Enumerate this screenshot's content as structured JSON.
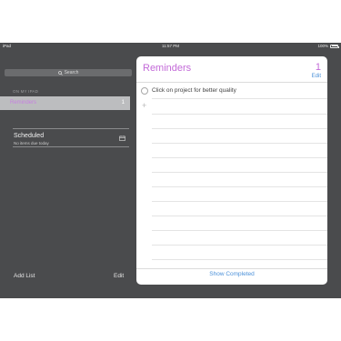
{
  "status_bar": {
    "device": "iPad",
    "time": "11:57 PM",
    "battery": "100%",
    "battery_level": 1.0
  },
  "sidebar": {
    "search_placeholder": "Search",
    "section_label": "ON MY IPAD",
    "selected_list": {
      "name": "Reminders",
      "count": "1",
      "accent_color": "#c77fe0"
    },
    "scheduled": {
      "title": "Scheduled",
      "subtitle": "No items due today"
    },
    "add_list_label": "Add List",
    "edit_label": "Edit"
  },
  "panel": {
    "title": "Reminders",
    "count": "1",
    "edit_label": "Edit",
    "items": [
      {
        "text": "Click on project for better quality",
        "completed": false
      }
    ],
    "add_symbol": "+",
    "show_completed_label": "Show Completed",
    "accent_color": "#c36ad8",
    "link_color": "#4a90d9"
  }
}
